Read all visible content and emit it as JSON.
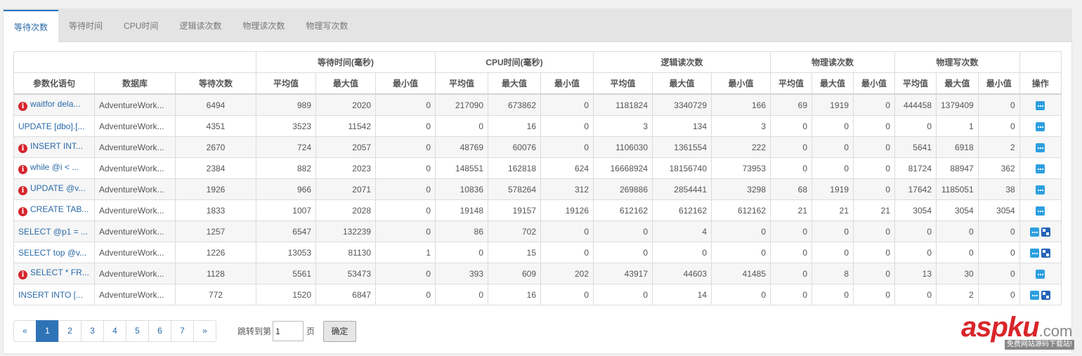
{
  "tabs": [
    "等待次数",
    "等待时间",
    "CPU时间",
    "逻辑读次数",
    "物理读次数",
    "物理写次数"
  ],
  "active_tab": 0,
  "table": {
    "group_headers": {
      "wait_time": "等待时间(毫秒)",
      "cpu_time": "CPU时间(毫秒)",
      "logical_reads": "逻辑读次数",
      "physical_reads": "物理读次数",
      "physical_writes": "物理写次数"
    },
    "columns": {
      "statement": "参数化语句",
      "database": "数据库",
      "wait_count": "等待次数",
      "avg": "平均值",
      "max": "最大值",
      "min": "最小值",
      "action": "操作"
    },
    "rows": [
      {
        "warn": true,
        "stmt": "waitfor dela...",
        "db": "AdventureWork...",
        "wait_count": "6494",
        "wt": [
          "989",
          "2020",
          "0"
        ],
        "cpu": [
          "217090",
          "673862",
          "0"
        ],
        "lr": [
          "1181824",
          "3340729",
          "166"
        ],
        "pr": [
          "69",
          "1919",
          "0"
        ],
        "pw": [
          "444458",
          "1379409",
          "0"
        ],
        "plan": false
      },
      {
        "warn": false,
        "stmt": "UPDATE [dbo].[...",
        "db": "AdventureWork...",
        "wait_count": "4351",
        "wt": [
          "3523",
          "11542",
          "0"
        ],
        "cpu": [
          "0",
          "16",
          "0"
        ],
        "lr": [
          "3",
          "134",
          "3"
        ],
        "pr": [
          "0",
          "0",
          "0"
        ],
        "pw": [
          "0",
          "1",
          "0"
        ],
        "plan": false
      },
      {
        "warn": true,
        "stmt": "INSERT INT...",
        "db": "AdventureWork...",
        "wait_count": "2670",
        "wt": [
          "724",
          "2057",
          "0"
        ],
        "cpu": [
          "48769",
          "60076",
          "0"
        ],
        "lr": [
          "1106030",
          "1361554",
          "222"
        ],
        "pr": [
          "0",
          "0",
          "0"
        ],
        "pw": [
          "5641",
          "6918",
          "2"
        ],
        "plan": false
      },
      {
        "warn": true,
        "stmt": "while @i < ...",
        "db": "AdventureWork...",
        "wait_count": "2384",
        "wt": [
          "882",
          "2023",
          "0"
        ],
        "cpu": [
          "148551",
          "162818",
          "624"
        ],
        "lr": [
          "16668924",
          "18156740",
          "73953"
        ],
        "pr": [
          "0",
          "0",
          "0"
        ],
        "pw": [
          "81724",
          "88947",
          "362"
        ],
        "plan": false
      },
      {
        "warn": true,
        "stmt": "UPDATE @v...",
        "db": "AdventureWork...",
        "wait_count": "1926",
        "wt": [
          "966",
          "2071",
          "0"
        ],
        "cpu": [
          "10836",
          "578264",
          "312"
        ],
        "lr": [
          "269886",
          "2854441",
          "3298"
        ],
        "pr": [
          "68",
          "1919",
          "0"
        ],
        "pw": [
          "17642",
          "1185051",
          "38"
        ],
        "plan": false
      },
      {
        "warn": true,
        "stmt": "CREATE TAB...",
        "db": "AdventureWork...",
        "wait_count": "1833",
        "wt": [
          "1007",
          "2028",
          "0"
        ],
        "cpu": [
          "19148",
          "19157",
          "19126"
        ],
        "lr": [
          "612162",
          "612162",
          "612162"
        ],
        "pr": [
          "21",
          "21",
          "21"
        ],
        "pw": [
          "3054",
          "3054",
          "3054"
        ],
        "plan": false
      },
      {
        "warn": false,
        "stmt": "SELECT @p1 = ...",
        "db": "AdventureWork...",
        "wait_count": "1257",
        "wt": [
          "6547",
          "132239",
          "0"
        ],
        "cpu": [
          "86",
          "702",
          "0"
        ],
        "lr": [
          "0",
          "4",
          "0"
        ],
        "pr": [
          "0",
          "0",
          "0"
        ],
        "pw": [
          "0",
          "0",
          "0"
        ],
        "plan": true
      },
      {
        "warn": false,
        "stmt": "SELECT top @v...",
        "db": "AdventureWork...",
        "wait_count": "1226",
        "wt": [
          "13053",
          "81130",
          "1"
        ],
        "cpu": [
          "0",
          "15",
          "0"
        ],
        "lr": [
          "0",
          "0",
          "0"
        ],
        "pr": [
          "0",
          "0",
          "0"
        ],
        "pw": [
          "0",
          "0",
          "0"
        ],
        "plan": true
      },
      {
        "warn": true,
        "stmt": "SELECT * FR...",
        "db": "AdventureWork...",
        "wait_count": "1128",
        "wt": [
          "5561",
          "53473",
          "0"
        ],
        "cpu": [
          "393",
          "609",
          "202"
        ],
        "lr": [
          "43917",
          "44603",
          "41485"
        ],
        "pr": [
          "0",
          "8",
          "0"
        ],
        "pw": [
          "13",
          "30",
          "0"
        ],
        "plan": false
      },
      {
        "warn": false,
        "stmt": "INSERT INTO [...",
        "db": "AdventureWork...",
        "wait_count": "772",
        "wt": [
          "1520",
          "6847",
          "0"
        ],
        "cpu": [
          "0",
          "16",
          "0"
        ],
        "lr": [
          "0",
          "14",
          "0"
        ],
        "pr": [
          "0",
          "0",
          "0"
        ],
        "pw": [
          "0",
          "2",
          "0"
        ],
        "plan": true
      }
    ]
  },
  "pagination": {
    "prev": "«",
    "pages": [
      "1",
      "2",
      "3",
      "4",
      "5",
      "6",
      "7"
    ],
    "active_page": "1",
    "next": "»",
    "jump_label": "跳转到第",
    "jump_value": "1",
    "page_suffix": "页",
    "confirm": "确定"
  },
  "watermark": {
    "brand": "aspku",
    "domain": ".com",
    "tagline": "免费网站源码下载站!"
  },
  "icons": {
    "warning": "warning-circle-icon",
    "details": "details-icon",
    "plan": "execution-plan-icon"
  },
  "colors": {
    "accent": "#2f73b7",
    "link": "#2a6aa8",
    "warning": "#d6262e",
    "action": "#2d9fe0"
  }
}
